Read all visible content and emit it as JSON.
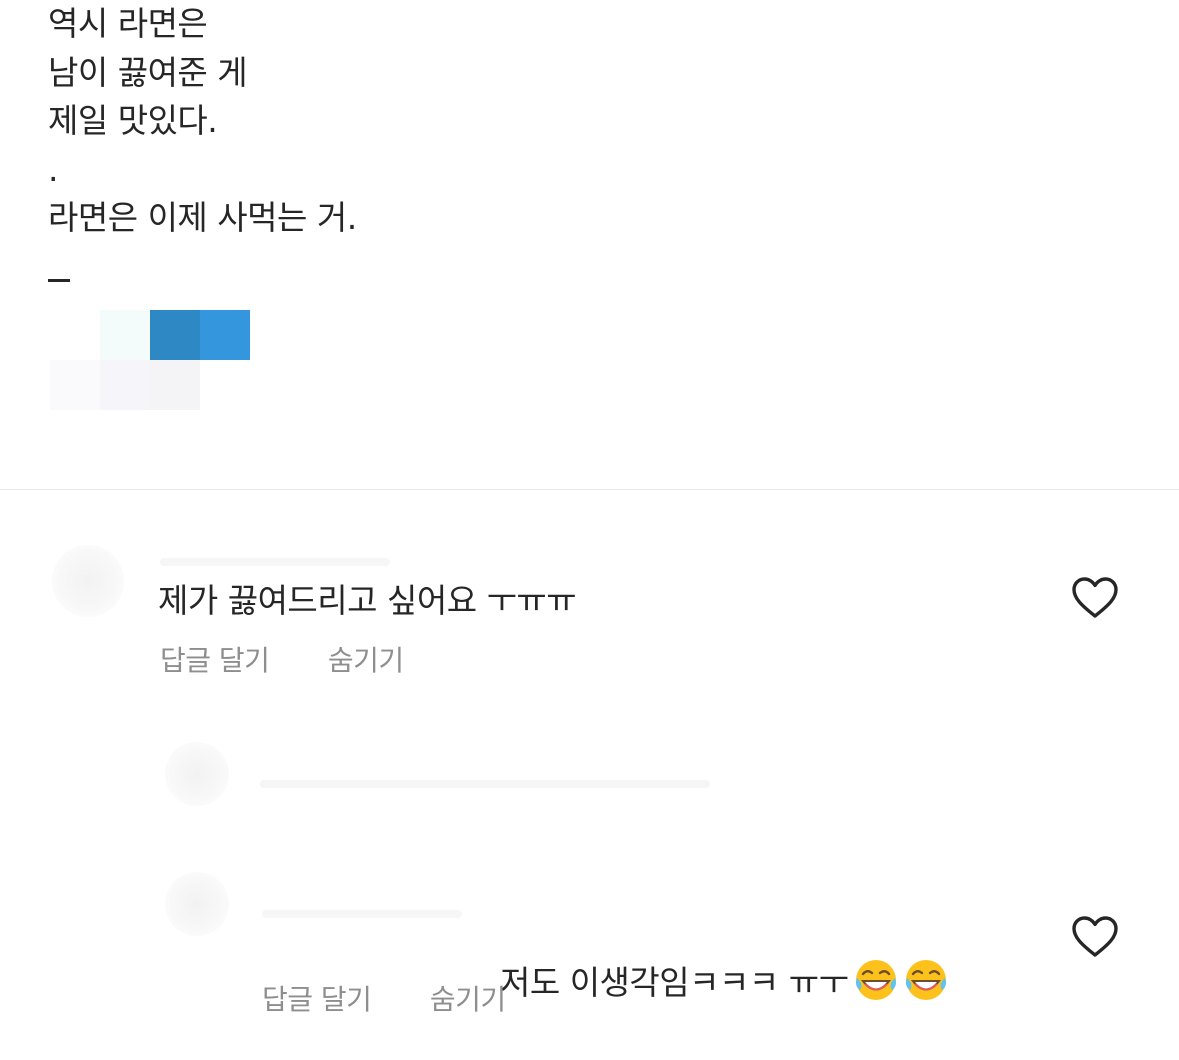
{
  "post": {
    "caption_lines": [
      "역시 라면은",
      "남이 끓여준 게",
      "제일 맛있다.",
      ".",
      "라면은 이제 사먹는 거."
    ],
    "caption_dash": "_"
  },
  "comments": [
    {
      "text": "제가 끓여드리고 싶어요 ㅜㅠㅠ",
      "reply_label": "답글 달기",
      "hide_label": "숨기기",
      "like_icon": "heart-outline-icon"
    },
    {
      "text": "저도 이생각임ㅋㅋㅋ ㅠㅜ",
      "emojis": [
        "face-with-tears-of-joy-emoji",
        "face-with-tears-of-joy-emoji"
      ],
      "reply_label": "답글 달기",
      "hide_label": "숨기기",
      "like_icon": "heart-outline-icon"
    }
  ],
  "colors": {
    "text": "#262626",
    "secondary": "#8e8e8e",
    "divider": "#ececec",
    "accent_dark": "#2e88c4",
    "accent": "#3496dc"
  }
}
